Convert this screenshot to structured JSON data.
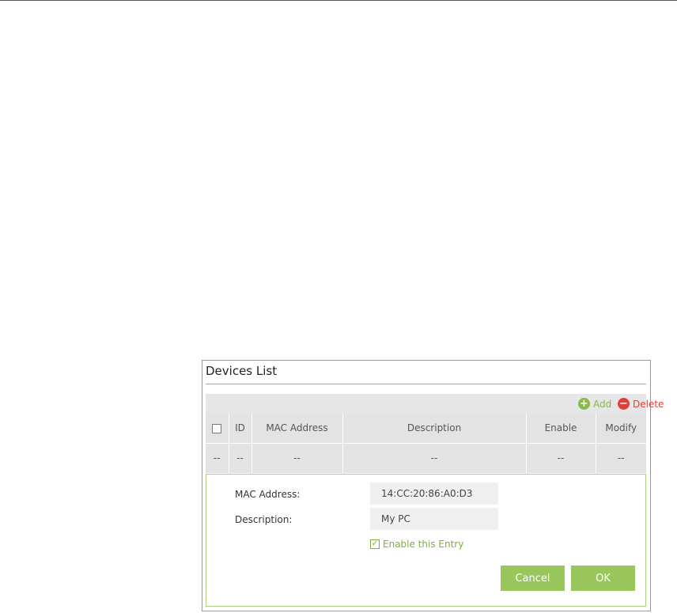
{
  "panel": {
    "title": "Devices List"
  },
  "toolbar": {
    "add_label": "Add",
    "delete_label": "Delete"
  },
  "table": {
    "headers": [
      "ID",
      "MAC Address",
      "Description",
      "Enable",
      "Modify"
    ],
    "rows": [
      [
        "--",
        "--",
        "--",
        "--",
        "--",
        "--"
      ]
    ]
  },
  "form": {
    "mac_label": "MAC Address:",
    "mac_value": "14:CC:20:86:A0:D3",
    "description_label": "Description:",
    "description_value": "My PC",
    "enable_label": "Enable this Entry",
    "enable_checked": true,
    "cancel_label": "Cancel",
    "ok_label": "OK"
  },
  "colors": {
    "accent_green": "#98c65a",
    "add_green": "#8ab849",
    "delete_red": "#e0403a"
  }
}
